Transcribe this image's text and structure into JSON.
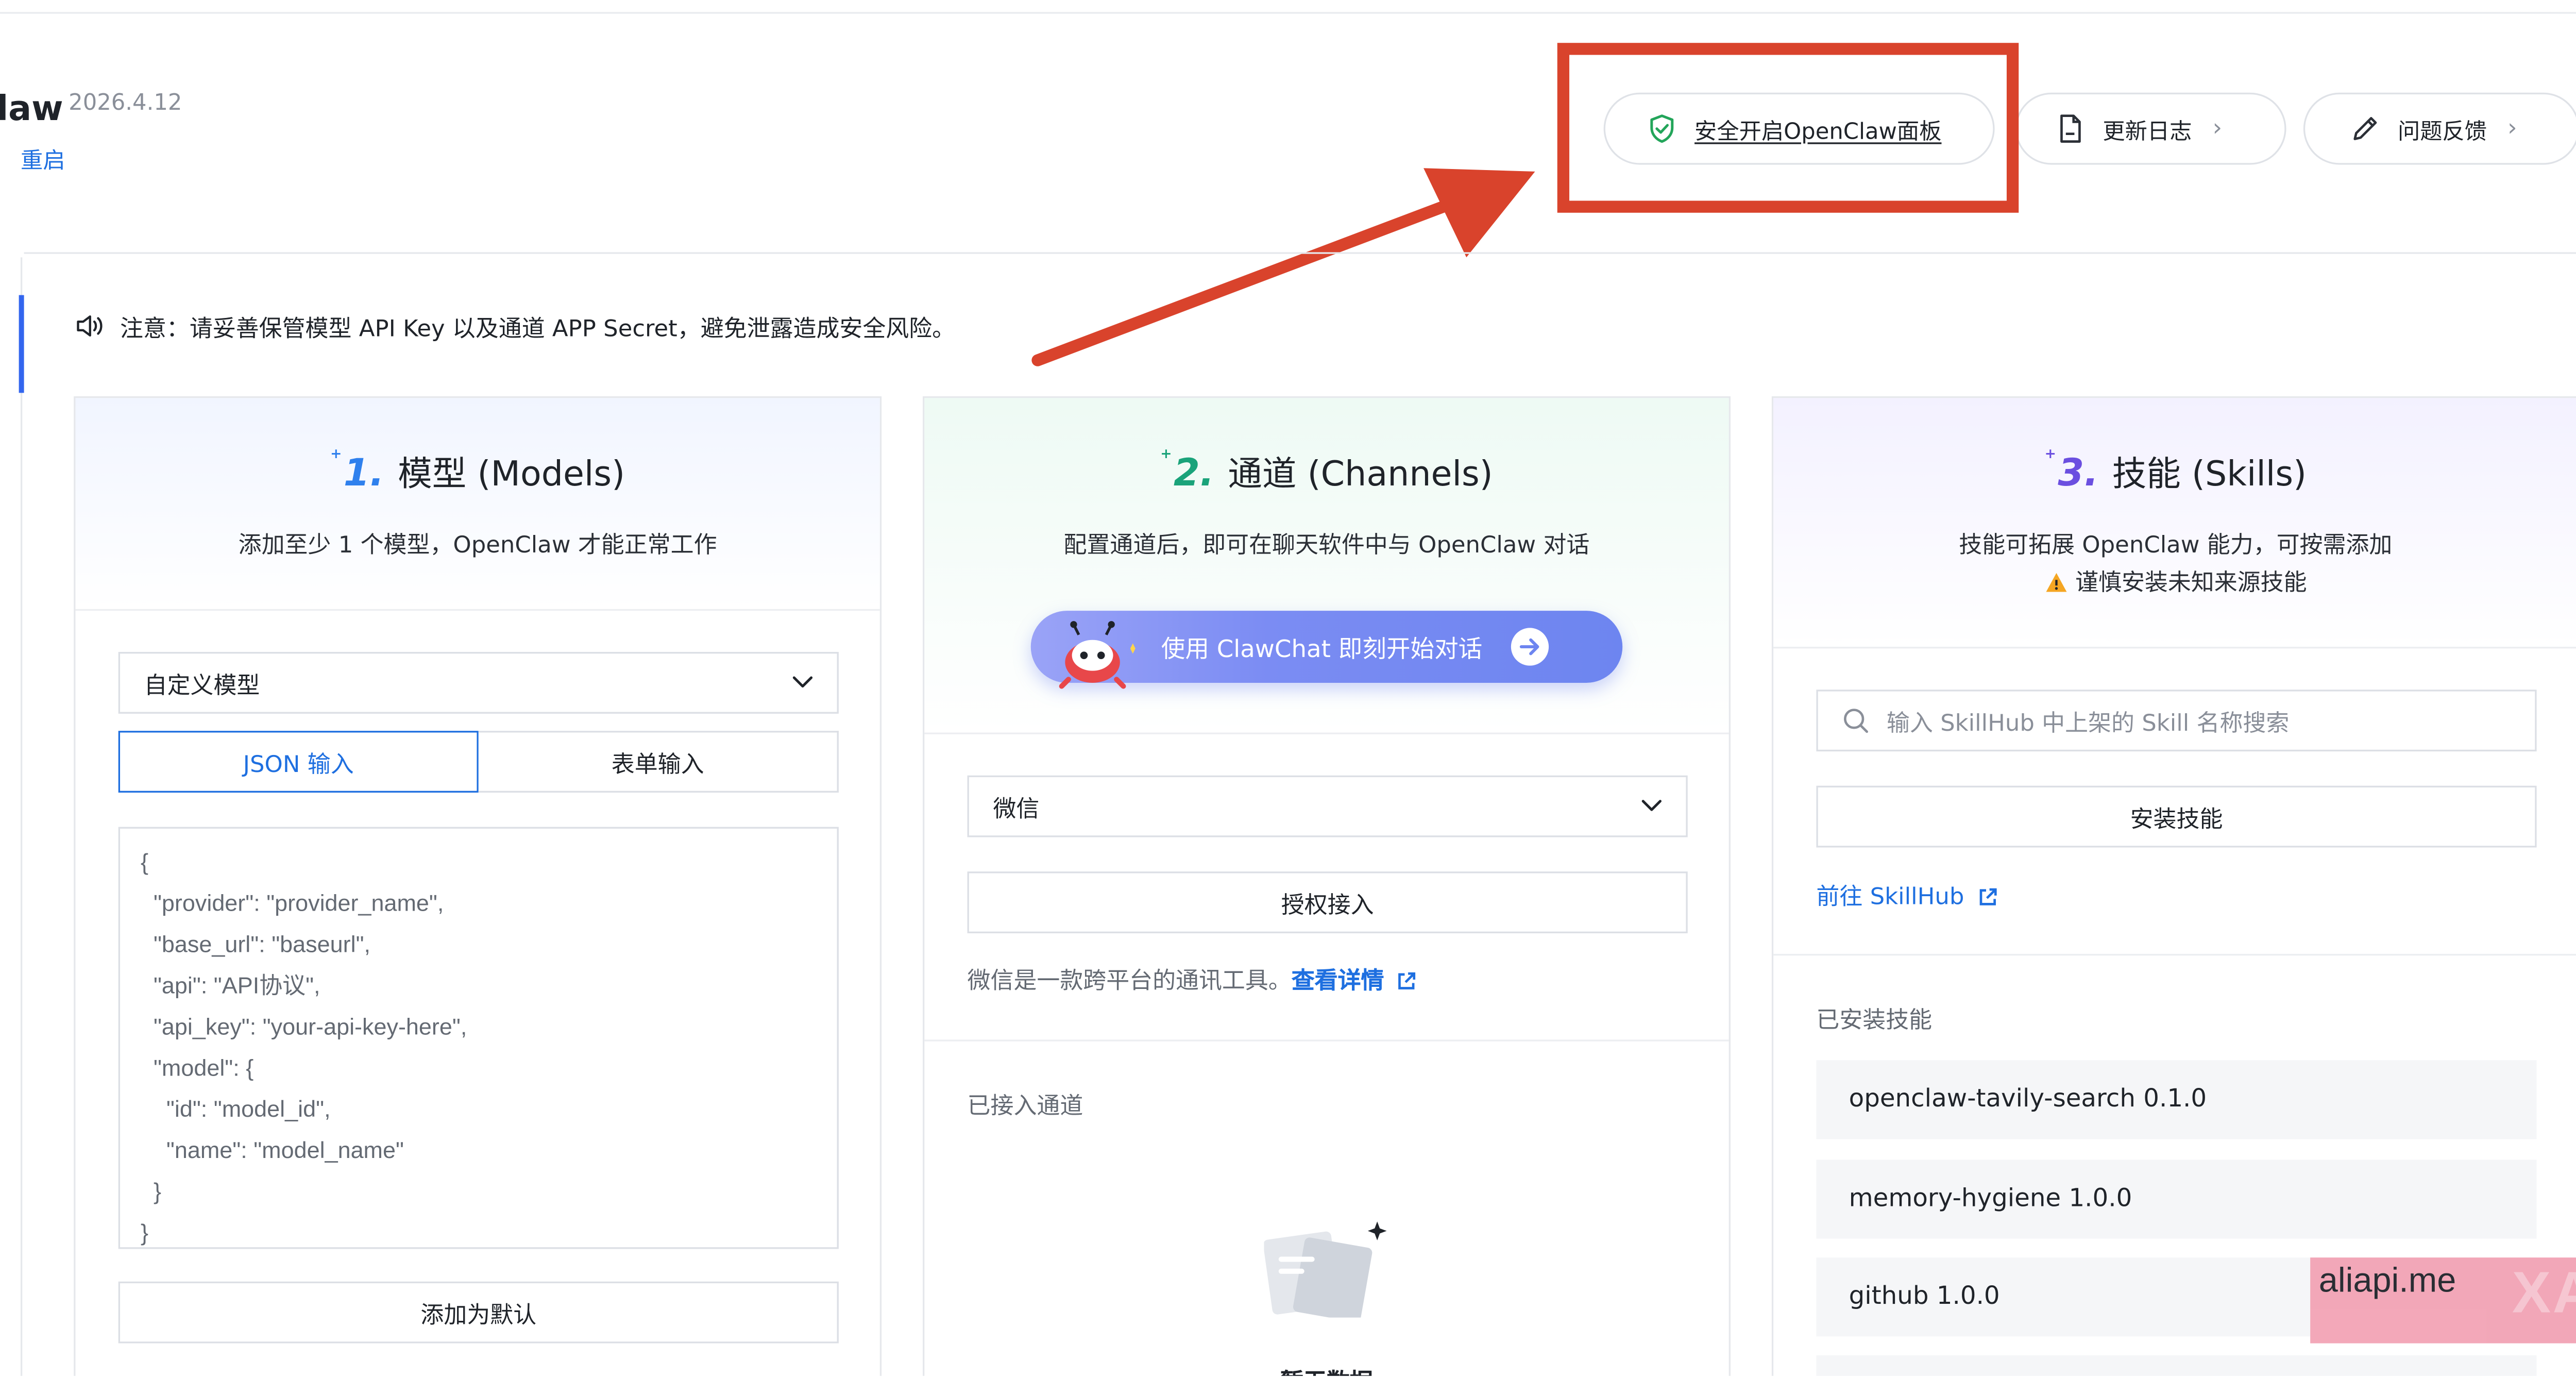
{
  "header": {
    "app_title": "law",
    "version": "2026.4.12",
    "restart_label": "重启",
    "secure_open_label": "安全开启OpenClaw面板",
    "changelog_label": "更新日志",
    "feedback_label": "问题反馈",
    "chevron": "›"
  },
  "notice": {
    "text": "注意：请妥善保管模型 API Key 以及通道 APP Secret，避免泄露造成安全风险。"
  },
  "models_card": {
    "step": "1.",
    "title": "模型 (Models)",
    "subtitle": "添加至少 1 个模型，OpenClaw 才能正常工作",
    "model_select_value": "自定义模型",
    "tab_json": "JSON 输入",
    "tab_form": "表单输入",
    "json_lines": [
      "{",
      "  \"provider\": \"provider_name\",",
      "  \"base_url\": \"baseurl\",",
      "  \"api\": \"API协议\",",
      "  \"api_key\": \"your-api-key-here\",",
      "  \"model\": {",
      "    \"id\": \"model_id\",",
      "    \"name\": \"model_name\"",
      "  }",
      "}"
    ],
    "add_default_label": "添加为默认"
  },
  "channels_card": {
    "step": "2.",
    "title": "通道 (Channels)",
    "subtitle": "配置通道后，即可在聊天软件中与 OpenClaw 对话",
    "clawchat_label": "使用 ClawChat 即刻开始对话",
    "channel_select_value": "微信",
    "authorize_label": "授权接入",
    "channel_desc": "微信是一款跨平台的通讯工具。",
    "details_link": "查看详情",
    "connected_label": "已接入通道",
    "empty_label": "暂无数据"
  },
  "skills_card": {
    "step": "3.",
    "title": "技能 (Skills)",
    "subtitle": "技能可拓展 OpenClaw 能力，可按需添加",
    "warning": "谨慎安装未知来源技能",
    "search_placeholder": "输入 SkillHub 中上架的 Skill 名称搜索",
    "install_label": "安装技能",
    "skillhub_link": "前往 SkillHub",
    "installed_label": "已安装技能",
    "skills": [
      "openclaw-tavily-search 0.1.0",
      "memory-hygiene 1.0.0",
      "github 1.0.0"
    ]
  },
  "watermark": {
    "text": "aliapi.me",
    "ghost": "XAPI"
  },
  "colors": {
    "accent_blue": "#1e6fe0",
    "annotation_red": "#d9432c",
    "step1": "#2f80ed",
    "step2": "#1aa37a",
    "step3": "#6b4fe0"
  }
}
